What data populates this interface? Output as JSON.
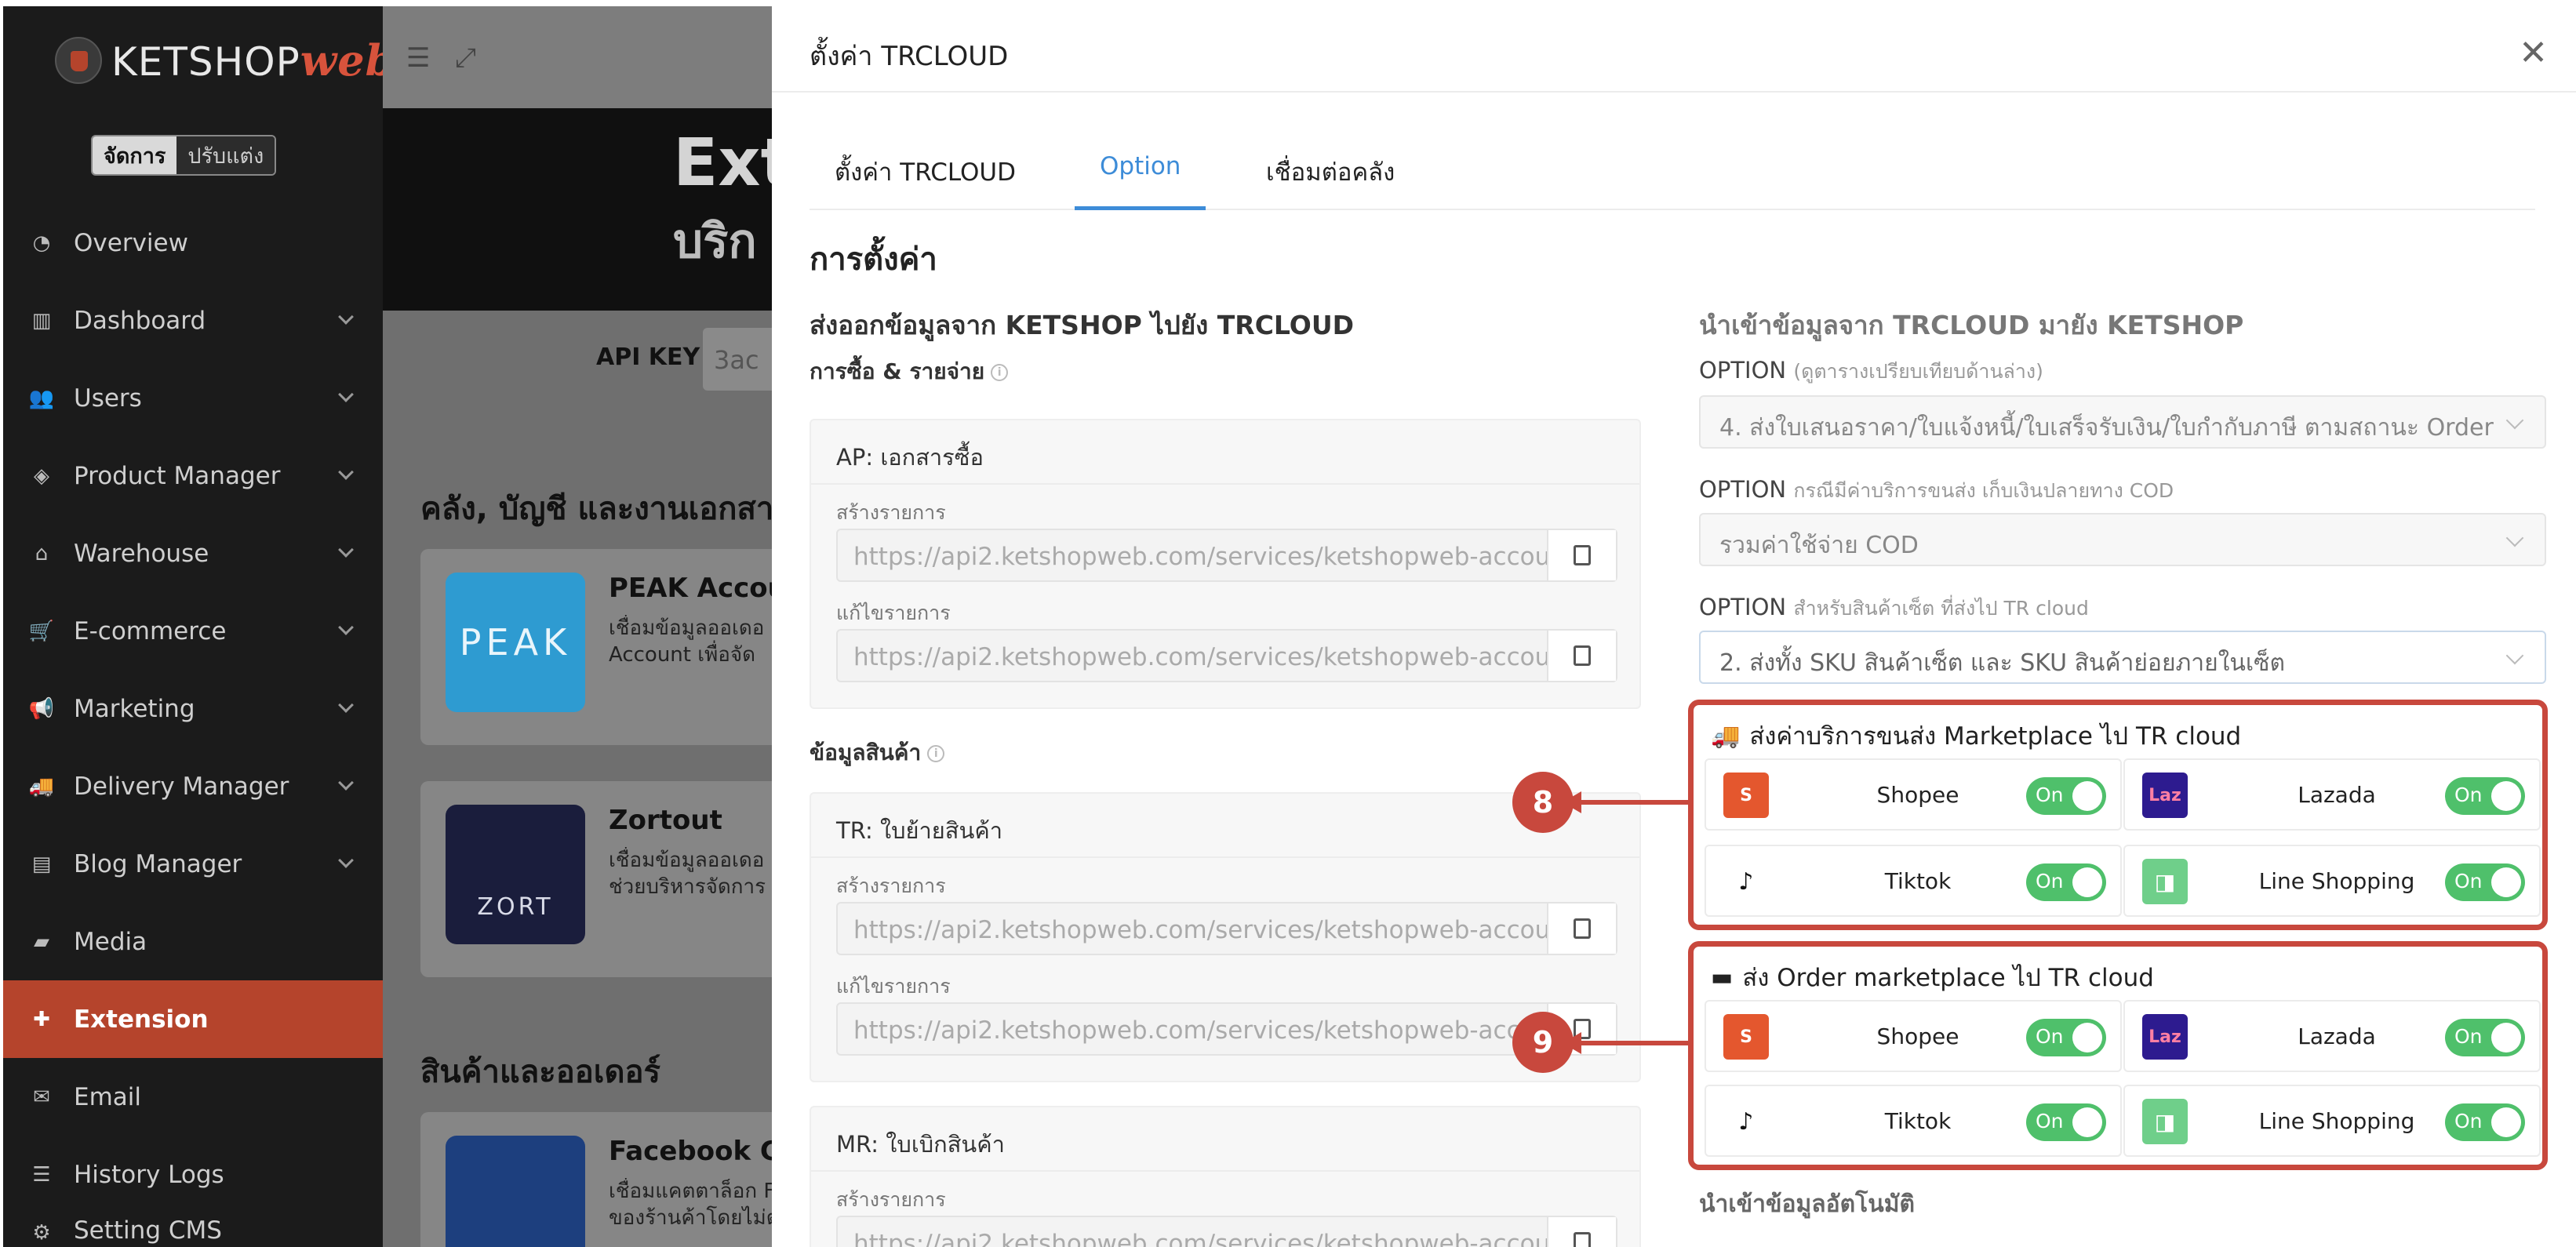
{
  "brand": {
    "name": "KETSHOP",
    "suffix": "web"
  },
  "sidebar": {
    "mode_active": "จัดการ",
    "mode_other": "ปรับแต่ง",
    "items": [
      {
        "label": "Overview"
      },
      {
        "label": "Dashboard"
      },
      {
        "label": "Users"
      },
      {
        "label": "Product Manager"
      },
      {
        "label": "Warehouse"
      },
      {
        "label": "E-commerce"
      },
      {
        "label": "Marketing"
      },
      {
        "label": "Delivery Manager"
      },
      {
        "label": "Blog Manager"
      },
      {
        "label": "Media"
      },
      {
        "label": "Extension"
      },
      {
        "label": "Email"
      },
      {
        "label": "History Logs"
      },
      {
        "label": "Setting CMS"
      }
    ]
  },
  "background": {
    "banner_title": "Ext",
    "banner_subtitle": "บริก",
    "api_label": "API KEY",
    "api_value": "3ac",
    "section1": "คลัง, บัญชี และงานเอกสา",
    "section2": "สินค้าและออเดอร์",
    "cards": [
      {
        "name": "PEAK Accou",
        "desc1": "เชื่อมข้อมูลออเดอ",
        "desc2": "Account เพื่อจัด",
        "logo": "PEAK"
      },
      {
        "name": "Zortout",
        "desc1": "เชื่อมข้อมูลออเดอ",
        "desc2": "ช่วยบริหารจัดการ",
        "logo": "ZORT"
      },
      {
        "name": "Facebook Ca",
        "desc1": "เชื่อมแคตตาล็อก F",
        "desc2": "ของร้านค้าโดยไม่ต"
      }
    ]
  },
  "modal": {
    "title": "ตั้งค่า TRCLOUD",
    "tabs": [
      "ตั้งค่า TRCLOUD",
      "Option",
      "เชื่อมต่อคลัง"
    ],
    "heading": "การตั้งค่า",
    "left": {
      "title": "ส่งออกข้อมูลจาก KETSHOP ไปยัง TRCLOUD",
      "purchase_label": "การซื้อ & รายจ่าย",
      "product_label": "ข้อมูลสินค้า",
      "ap_box": "AP: เอกสารซื้อ",
      "tr_box": "TR: ใบย้ายสินค้า",
      "mr_box": "MR: ใบเบิกสินค้า",
      "create_label": "สร้างรายการ",
      "edit_label": "แก้ไขรายการ",
      "url": "https://api2.ketshopweb.com/services/ketshopweb-accoun"
    },
    "right": {
      "title": "นำเข้าข้อมูลจาก TRCLOUD มายัง KETSHOP",
      "opt1_label": "OPTION",
      "opt1_hint": "(ดูตารางเปรียบเทียบด้านล่าง)",
      "opt1_value": "4. ส่งใบเสนอราคา/ใบแจ้งหนี้/ใบเสร็จรับเงิน/ใบกำกับภาษี ตามสถานะ Order",
      "opt2_label": "OPTION",
      "opt2_hint": "กรณีมีค่าบริการขนส่ง เก็บเงินปลายทาง COD",
      "opt2_value": "รวมค่าใช้จ่าย COD",
      "opt3_label": "OPTION",
      "opt3_hint": "สำหรับสินค้าเซ็ต ที่ส่งไป TR cloud",
      "opt3_value": "2. ส่งทั้ง SKU สินค้าเซ็ต และ SKU สินค้าย่อยภายในเซ็ต",
      "group1_title": "ส่งค่าบริการขนส่ง Marketplace ไป TR cloud",
      "group2_title": "ส่ง Order marketplace ไป TR cloud",
      "marketplaces": [
        {
          "name": "Shopee",
          "state": "On",
          "color": "#e4572e"
        },
        {
          "name": "Lazada",
          "state": "On",
          "color": "#2d1b8f"
        },
        {
          "name": "Tiktok",
          "state": "On",
          "color": "#ffffff"
        },
        {
          "name": "Line Shopping",
          "state": "On",
          "color": "#6fcf8a"
        }
      ],
      "auto_import": "นำเข้าข้อมูลอัตโนมัติ"
    }
  },
  "annotations": {
    "badge1": "8",
    "badge2": "9"
  },
  "colors": {
    "accent": "#3d8cd8",
    "highlight": "#c8483d",
    "toggle_on": "#4fc06b",
    "sidebar_active": "#b5442c"
  }
}
